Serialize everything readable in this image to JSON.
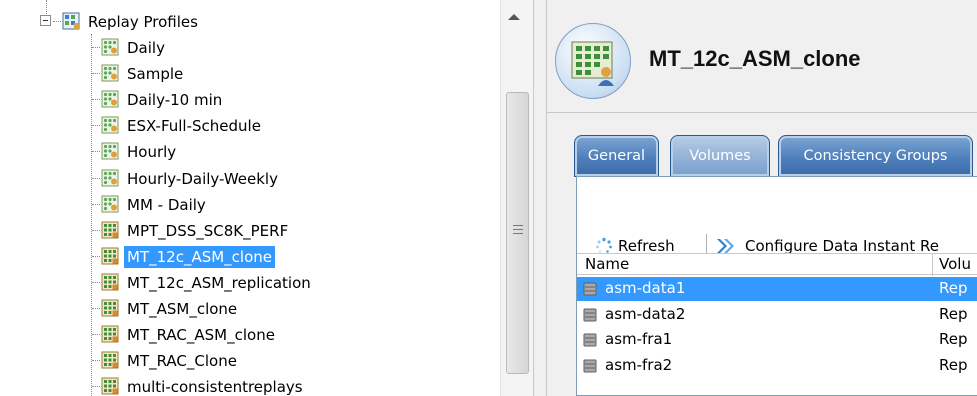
{
  "tree": {
    "root_label": "Replay Profiles",
    "items": [
      {
        "label": "Daily",
        "icon": "replay-profile-icon",
        "selected": false
      },
      {
        "label": "Sample",
        "icon": "replay-profile-icon",
        "selected": false
      },
      {
        "label": "Daily-10 min",
        "icon": "replay-profile-icon",
        "selected": false
      },
      {
        "label": "ESX-Full-Schedule",
        "icon": "replay-profile-icon",
        "selected": false
      },
      {
        "label": "Hourly",
        "icon": "replay-profile-icon",
        "selected": false
      },
      {
        "label": "Hourly-Daily-Weekly",
        "icon": "replay-profile-icon",
        "selected": false
      },
      {
        "label": "MM - Daily",
        "icon": "replay-profile-icon",
        "selected": false
      },
      {
        "label": "MPT_DSS_SC8K_PERF",
        "icon": "consistent-replay-profile-icon",
        "selected": false
      },
      {
        "label": "MT_12c_ASM_clone",
        "icon": "consistent-replay-profile-icon",
        "selected": true
      },
      {
        "label": "MT_12c_ASM_replication",
        "icon": "consistent-replay-profile-icon",
        "selected": false
      },
      {
        "label": "MT_ASM_clone",
        "icon": "consistent-replay-profile-icon",
        "selected": false
      },
      {
        "label": "MT_RAC_ASM_clone",
        "icon": "consistent-replay-profile-icon",
        "selected": false
      },
      {
        "label": "MT_RAC_Clone",
        "icon": "consistent-replay-profile-icon",
        "selected": false
      },
      {
        "label": "multi-consistentreplays",
        "icon": "consistent-replay-profile-icon",
        "selected": false
      }
    ]
  },
  "detail": {
    "title": "MT_12c_ASM_clone",
    "tabs": [
      {
        "label": "General",
        "active": false
      },
      {
        "label": "Volumes",
        "active": true
      },
      {
        "label": "Consistency Groups",
        "active": false
      }
    ],
    "toolbar": {
      "refresh_label": "Refresh",
      "configure_label": "Configure Data Instant Re"
    },
    "table": {
      "columns": [
        "Name",
        "Volu"
      ],
      "rows": [
        {
          "name": "asm-data1",
          "type": "Rep",
          "selected": true
        },
        {
          "name": "asm-data2",
          "type": "Rep",
          "selected": false
        },
        {
          "name": "asm-fra1",
          "type": "Rep",
          "selected": false
        },
        {
          "name": "asm-fra2",
          "type": "Rep",
          "selected": false
        }
      ]
    }
  },
  "colors": {
    "selection": "#3399ff",
    "tab": "#4e7fbc"
  }
}
